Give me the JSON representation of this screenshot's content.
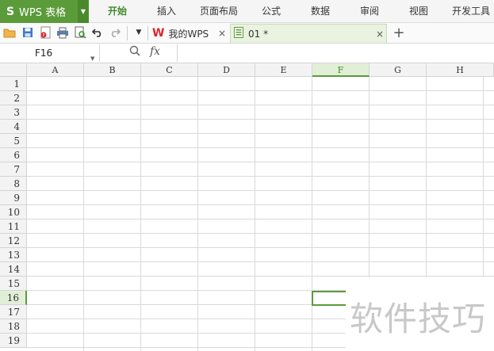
{
  "app": {
    "title": "WPS 表格",
    "logo": "S"
  },
  "menu": {
    "items": [
      {
        "label": "开始",
        "active": true
      },
      {
        "label": "插入",
        "active": false
      },
      {
        "label": "页面布局",
        "active": false
      },
      {
        "label": "公式",
        "active": false
      },
      {
        "label": "数据",
        "active": false
      },
      {
        "label": "审阅",
        "active": false
      },
      {
        "label": "视图",
        "active": false
      },
      {
        "label": "开发工具",
        "active": false
      }
    ]
  },
  "toolbar": {
    "icons": [
      "open-folder-icon",
      "save-icon",
      "export-pdf-icon",
      "print-icon",
      "print-preview-icon",
      "undo-icon",
      "redo-icon",
      "customize-dropdown-icon"
    ]
  },
  "doc_tabs": [
    {
      "label": "我的WPS",
      "icon": "wps-logo-icon",
      "active": false
    },
    {
      "label": "01 *",
      "icon": "spreadsheet-doc-icon",
      "active": true
    }
  ],
  "formula_bar": {
    "cell_ref": "F16",
    "fx_label": "fx",
    "value": ""
  },
  "grid": {
    "columns": [
      "A",
      "B",
      "C",
      "D",
      "E",
      "F",
      "G",
      "H"
    ],
    "rows": [
      "1",
      "2",
      "3",
      "4",
      "5",
      "6",
      "7",
      "8",
      "9",
      "10",
      "11",
      "12",
      "13",
      "14",
      "15",
      "16",
      "17",
      "18",
      "19"
    ],
    "selected_column": "F",
    "selected_row": "16"
  },
  "watermark": "软件技巧",
  "colors": {
    "accent": "#5b9b3a",
    "accent_light": "#e2efd7",
    "wps_red": "#d9262c"
  }
}
